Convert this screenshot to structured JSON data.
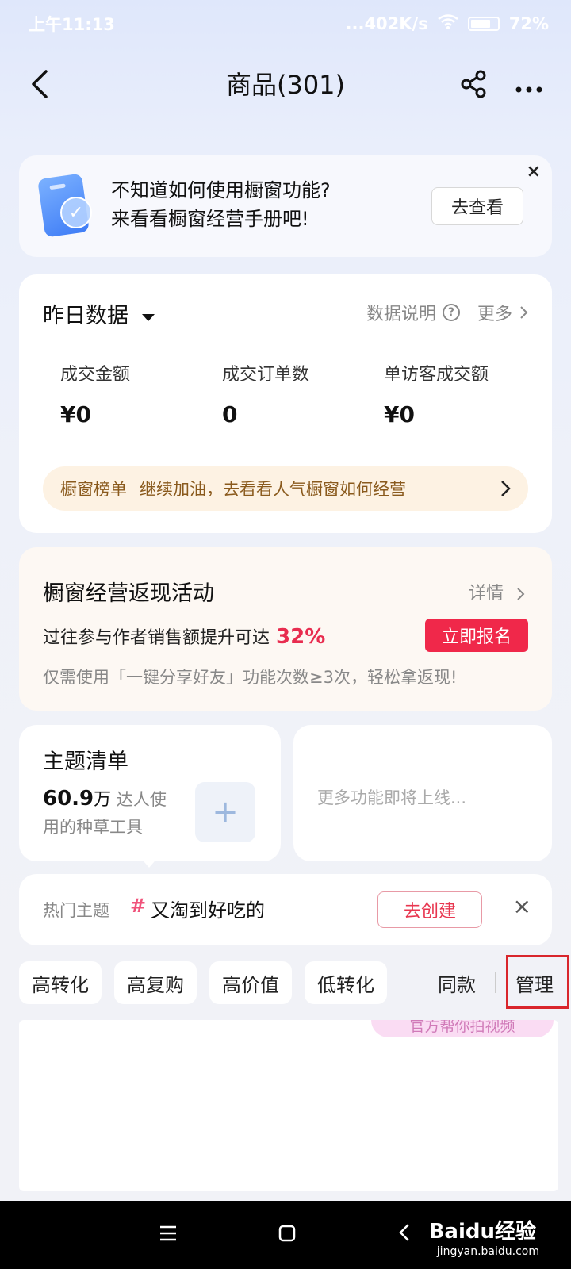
{
  "status_bar": {
    "time": "上午11:13",
    "network": "...402K/s",
    "battery": "72%"
  },
  "header": {
    "title": "商品(301)"
  },
  "banner": {
    "line1": "不知道如何使用橱窗功能?",
    "line2": "来看看橱窗经营手册吧!",
    "button": "去查看",
    "close": "×"
  },
  "stats": {
    "title": "昨日数据",
    "explain": "数据说明",
    "more": "更多",
    "metrics": [
      {
        "label": "成交金额",
        "value": "¥0"
      },
      {
        "label": "成交订单数",
        "value": "0"
      },
      {
        "label": "单访客成交额",
        "value": "¥0"
      }
    ],
    "rank_label": "橱窗榜单",
    "rank_text": "继续加油，去看看人气橱窗如何经营"
  },
  "promo": {
    "title": "橱窗经营返现活动",
    "detail": "详情",
    "line_prefix": "过往参与作者销售额提升可达",
    "line_pct": "32%",
    "button": "立即报名",
    "subtext": "仅需使用「一键分享好友」功能次数≥3次，轻松拿返现!"
  },
  "theme": {
    "title": "主题清单",
    "count": "60.9",
    "count_unit": "万",
    "desc_tail": "达人使用的种草工具",
    "plus": "+"
  },
  "coming": {
    "text": "更多功能即将上线..."
  },
  "hot": {
    "label": "热门主题",
    "hash": "#",
    "topic": "又淘到好吃的",
    "button": "去创建",
    "close": "×"
  },
  "chips": [
    "高转化",
    "高复购",
    "高价值",
    "低转化"
  ],
  "tools": {
    "same": "同款",
    "manage": "管理"
  },
  "list": {
    "tip": "官方帮你拍视频"
  },
  "watermark": {
    "logo": "Baidu经验",
    "url": "jingyan.baidu.com"
  }
}
